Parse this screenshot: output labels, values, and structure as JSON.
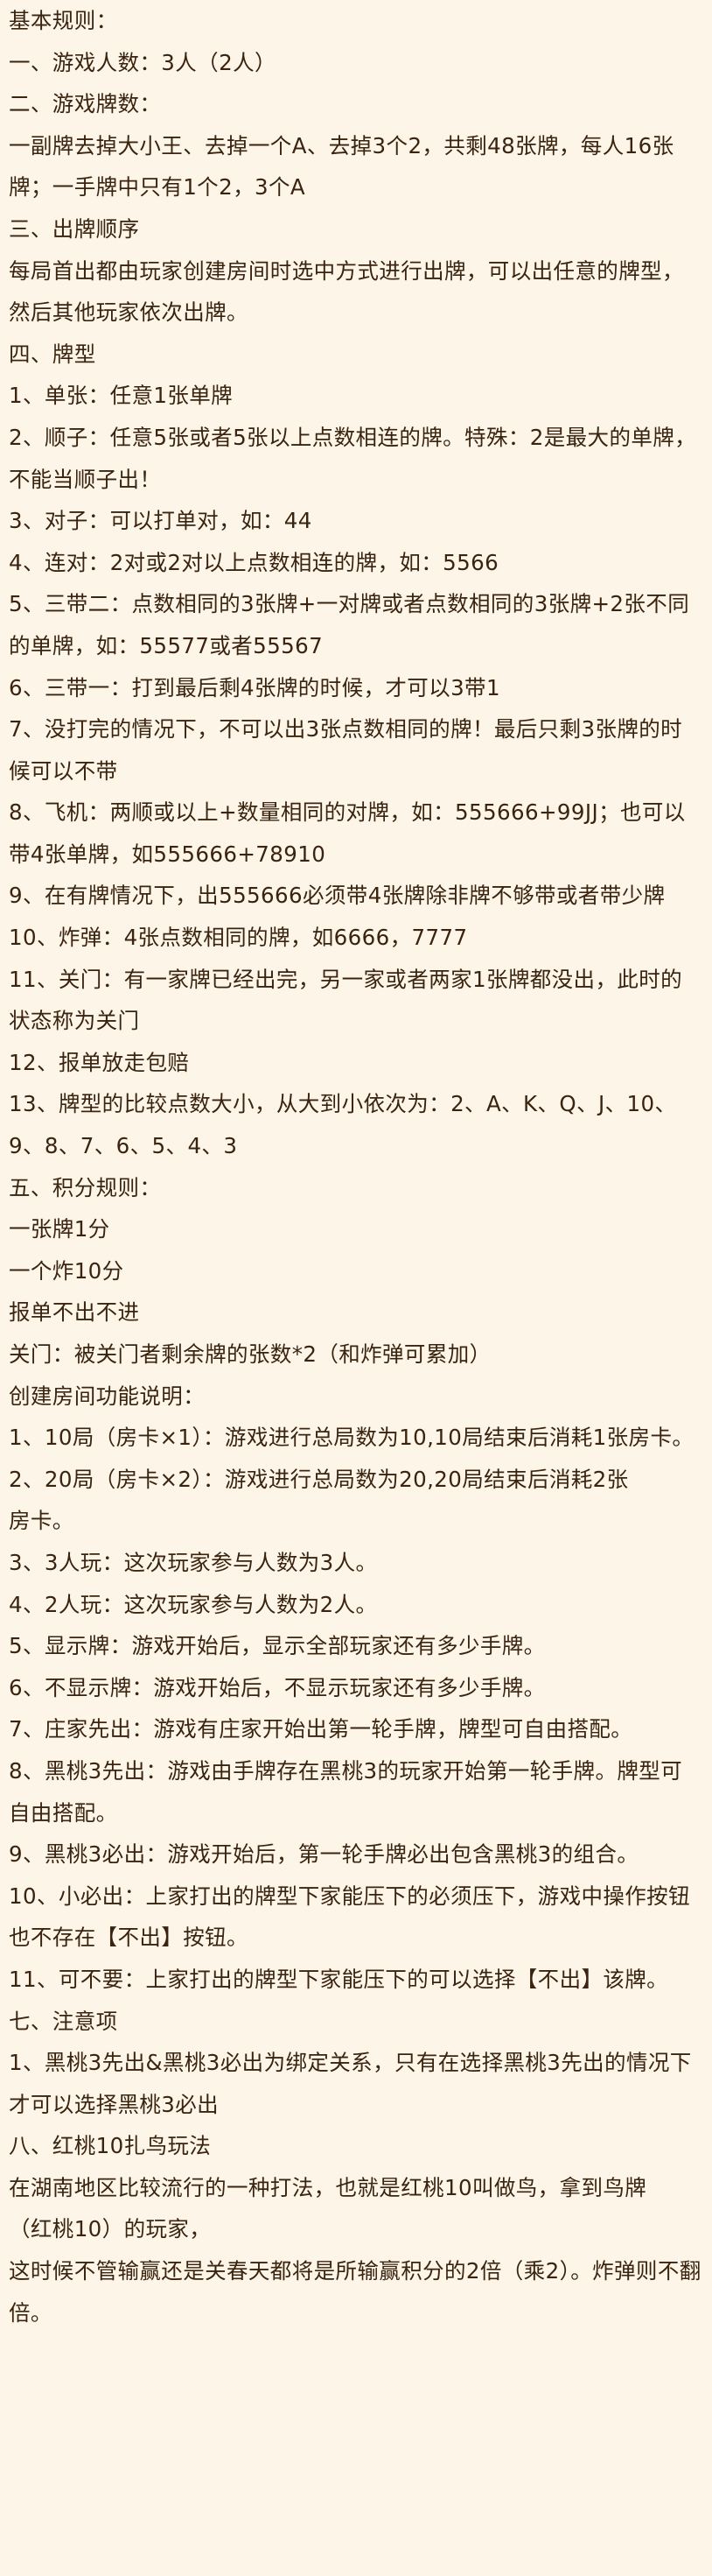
{
  "rules": {
    "lines": [
      "基本规则：",
      "一、游戏人数：3人（2人）",
      "二、游戏牌数：",
      "一副牌去掉大小王、去掉一个A、去掉3个2，共剩48张牌，每人16张牌；一手牌中只有1个2，3个A",
      "三、出牌顺序",
      "每局首出都由玩家创建房间时选中方式进行出牌，可以出任意的牌型，然后其他玩家依次出牌。",
      "四、牌型",
      "1、单张：任意1张单牌",
      "2、顺子：任意5张或者5张以上点数相连的牌。特殊：2是最大的单牌，不能当顺子出！",
      "3、对子：可以打单对，如：44",
      "4、连对：2对或2对以上点数相连的牌，如：5566",
      "5、三带二：点数相同的3张牌+一对牌或者点数相同的3张牌+2张不同的单牌，如：55577或者55567",
      "6、三带一：打到最后剩4张牌的时候，才可以3带1",
      "7、没打完的情况下，不可以出3张点数相同的牌！最后只剩3张牌的时候可以不带",
      "8、飞机：两顺或以上+数量相同的对牌，如：555666+99JJ；也可以带4张单牌，如555666+78910",
      "9、在有牌情况下，出555666必须带4张牌除非牌不够带或者带少牌",
      "10、炸弹：4张点数相同的牌，如6666，7777",
      "11、关门：有一家牌已经出完，另一家或者两家1张牌都没出，此时的状态称为关门",
      "12、报单放走包赔",
      "13、牌型的比较点数大小，从大到小依次为：2、A、K、Q、J、10、9、8、7、6、5、4、3",
      "五、积分规则：",
      "一张牌1分",
      "一个炸10分",
      "报单不出不进",
      "关门：被关门者剩余牌的张数*2（和炸弹可累加）",
      "创建房间功能说明：",
      "1、10局（房卡×1）：游戏进行总局数为10,10局结束后消耗1张房卡。",
      "2、20局（房卡×2）：游戏进行总局数为20,20局结束后消耗2张",
      "房卡。",
      "3、3人玩：这次玩家参与人数为3人。",
      "4、2人玩：这次玩家参与人数为2人。",
      "5、显示牌：游戏开始后，显示全部玩家还有多少手牌。",
      "6、不显示牌：游戏开始后，不显示玩家还有多少手牌。",
      "7、庄家先出：游戏有庄家开始出第一轮手牌，牌型可自由搭配。",
      "8、黑桃3先出：游戏由手牌存在黑桃3的玩家开始第一轮手牌。牌型可自由搭配。",
      "9、黑桃3必出：游戏开始后，第一轮手牌必出包含黑桃3的组合。",
      "10、小必出：上家打出的牌型下家能压下的必须压下，游戏中操作按钮也不存在【不出】按钮。",
      "11、可不要：上家打出的牌型下家能压下的可以选择【不出】该牌。",
      "七、注意项",
      "1、黑桃3先出&黑桃3必出为绑定关系，只有在选择黑桃3先出的情况下才可以选择黑桃3必出",
      "八、红桃10扎鸟玩法",
      "在湖南地区比较流行的一种打法，也就是红桃10叫做鸟，拿到鸟牌",
      "（红桃10）的玩家，",
      "这时候不管输赢还是关春天都将是所输赢积分的2倍（乘2）。炸弹则不翻倍。"
    ]
  }
}
